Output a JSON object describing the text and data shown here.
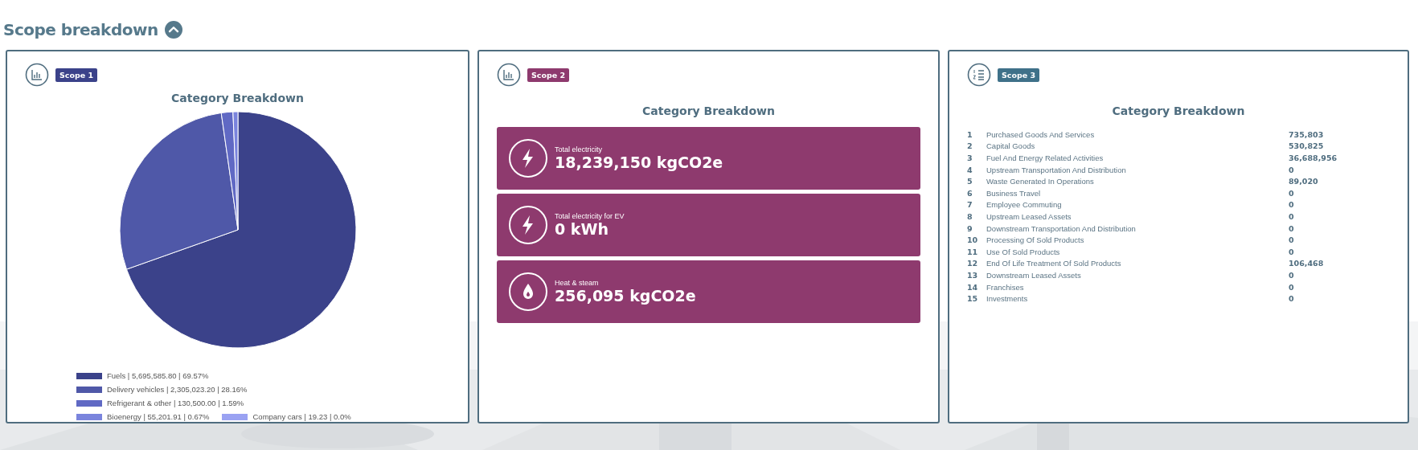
{
  "section": {
    "title": "Scope breakdown",
    "expanded": true
  },
  "cards": [
    {
      "kind": "pie",
      "badge": "Scope 1",
      "color": "#3b428a",
      "heading": "Category Breakdown",
      "chart_data": {
        "type": "pie",
        "categories": [
          "Fuels",
          "Delivery vehicles",
          "Refrigerant & other",
          "Bioenergy",
          "Company cars"
        ],
        "values": [
          69.57,
          28.16,
          1.59,
          0.67,
          0.0
        ]
      },
      "legend": [
        {
          "detail": "| 5,695,585.80 | 69.57%",
          "color": "#3b428a"
        },
        {
          "detail": "| 2,305,023.20 | 28.16%",
          "color": "#4f58a8"
        },
        {
          "detail": "| 130,500.00 | 1.59%",
          "color": "#6069c4"
        },
        {
          "detail": "| 55,201.91 | 0.67%",
          "color": "#7a84dd"
        },
        {
          "detail": "| 19.23 | 0.0%",
          "color": "#9aa2f2"
        }
      ]
    },
    {
      "kind": "tiles",
      "badge": "Scope 2",
      "color": "#8e3a6e",
      "heading": "Category Breakdown",
      "tiles": [
        {
          "kind": "electricity",
          "label": "Total electricity",
          "value": "18,239,150 kgCO2e"
        },
        {
          "kind": "electricity",
          "label": "Total electricity for EV",
          "value": "0 kWh"
        },
        {
          "kind": "heat",
          "label": "Heat & steam",
          "value": "256,095 kgCO2e"
        }
      ]
    },
    {
      "kind": "list",
      "badge": "Scope 3",
      "color": "#3f7189",
      "heading": "Category Breakdown",
      "rows": [
        {
          "number": "1",
          "name": "Purchased Goods And Services",
          "value": "735,803"
        },
        {
          "number": "2",
          "name": "Capital Goods",
          "value": "530,825"
        },
        {
          "number": "3",
          "name": "Fuel And Energy Related Activities",
          "value": "36,688,956"
        },
        {
          "number": "4",
          "name": "Upstream Transportation And Distribution",
          "value": "0"
        },
        {
          "number": "5",
          "name": "Waste Generated In Operations",
          "value": "89,020"
        },
        {
          "number": "6",
          "name": "Business Travel",
          "value": "0"
        },
        {
          "number": "7",
          "name": "Employee Commuting",
          "value": "0"
        },
        {
          "number": "8",
          "name": "Upstream Leased Assets",
          "value": "0"
        },
        {
          "number": "9",
          "name": "Downstream Transportation And Distribution",
          "value": "0"
        },
        {
          "number": "10",
          "name": "Processing Of Sold Products",
          "value": "0"
        },
        {
          "number": "11",
          "name": "Use Of Sold Products",
          "value": "0"
        },
        {
          "number": "12",
          "name": "End Of Life Treatment Of Sold Products",
          "value": "106,468"
        },
        {
          "number": "13",
          "name": "Downstream Leased Assets",
          "value": "0"
        },
        {
          "number": "14",
          "name": "Franchises",
          "value": "0"
        },
        {
          "number": "15",
          "name": "Investments",
          "value": "0"
        }
      ]
    }
  ]
}
